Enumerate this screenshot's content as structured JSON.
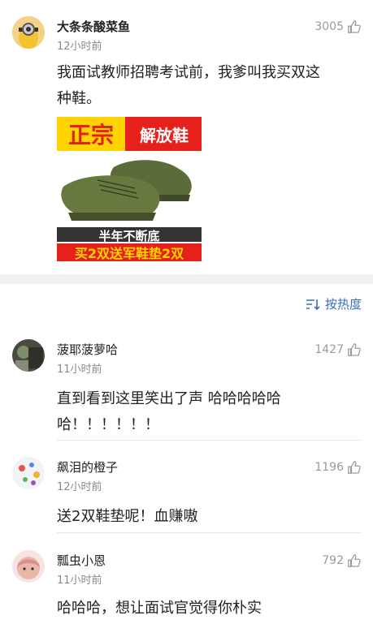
{
  "post": {
    "author": "大条条酸菜鱼",
    "time": "12小时前",
    "likes": "3005",
    "text_line1": "我面试教师招聘考试前，我爹叫我买双这",
    "text_line2": "种鞋。",
    "ad": {
      "big_text": "正宗",
      "small_text": "解放鞋",
      "line1": "半年不断底",
      "line2": "买2双送军鞋垫2双"
    }
  },
  "sort_label": "按热度",
  "comments": [
    {
      "author": "菠耶菠萝哈",
      "time": "11小时前",
      "likes": "1427",
      "line1": "直到看到这里笑出了声 哈哈哈哈哈",
      "line2": "哈！！！！！！"
    },
    {
      "author": "飙泪的橙子",
      "time": "12小时前",
      "likes": "1196",
      "line1": "送2双鞋垫呢！血赚嗷"
    },
    {
      "author": "瓢虫小恩",
      "time": "11小时前",
      "likes": "792",
      "line1": "哈哈哈，想让面试官觉得你朴实"
    }
  ],
  "colors": {
    "accent_blue": "#3a6fb8",
    "ad_red": "#e6201b",
    "ad_yellow": "#ffd400"
  }
}
